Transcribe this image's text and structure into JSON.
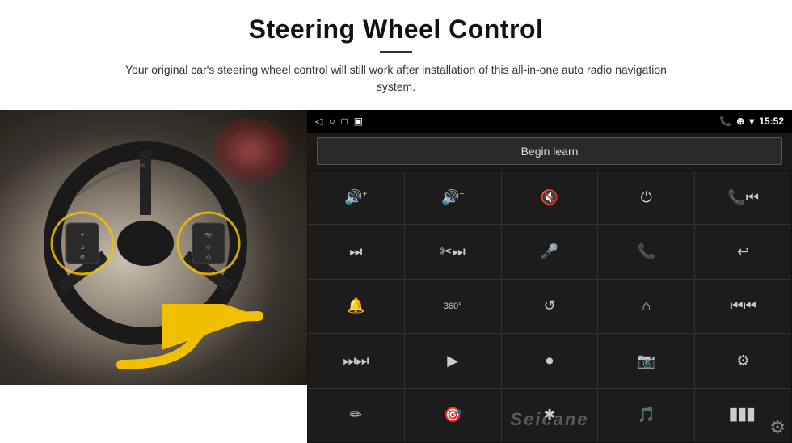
{
  "header": {
    "title": "Steering Wheel Control",
    "subtitle": "Your original car's steering wheel control will still work after installation of this all-in-one auto radio navigation system."
  },
  "status_bar": {
    "left_icons": [
      "◁",
      "○",
      "□",
      "▣"
    ],
    "time": "15:52",
    "right_icons": [
      "📞",
      "⊕",
      "▾"
    ]
  },
  "begin_learn": {
    "label": "Begin learn"
  },
  "controls": [
    {
      "icon": "🔊+",
      "label": "volume-up"
    },
    {
      "icon": "🔊−",
      "label": "volume-down"
    },
    {
      "icon": "🔇",
      "label": "mute"
    },
    {
      "icon": "⏻",
      "label": "power"
    },
    {
      "icon": "⏮",
      "label": "prev-track-end"
    },
    {
      "icon": "⏭",
      "label": "next"
    },
    {
      "icon": "⚡⏭",
      "label": "fast-forward"
    },
    {
      "icon": "🎤",
      "label": "mic"
    },
    {
      "icon": "📞",
      "label": "call"
    },
    {
      "icon": "↩",
      "label": "hang-up"
    },
    {
      "icon": "🔔",
      "label": "alert"
    },
    {
      "icon": "360",
      "label": "360-view"
    },
    {
      "icon": "↺",
      "label": "back"
    },
    {
      "icon": "⌂",
      "label": "home"
    },
    {
      "icon": "⏮⏮",
      "label": "rewind"
    },
    {
      "icon": "⏭⏭",
      "label": "skip"
    },
    {
      "icon": "▶",
      "label": "navigate"
    },
    {
      "icon": "⏺",
      "label": "eject"
    },
    {
      "icon": "📷",
      "label": "camera"
    },
    {
      "icon": "⚙",
      "label": "settings-ctrl"
    },
    {
      "icon": "✏",
      "label": "edit"
    },
    {
      "icon": "⊕",
      "label": "target"
    },
    {
      "icon": "✱",
      "label": "bluetooth"
    },
    {
      "icon": "♪⚙",
      "label": "music-settings"
    },
    {
      "icon": "▋▋▋",
      "label": "equalizer"
    }
  ],
  "watermark": "Seicane",
  "gear": "⚙"
}
